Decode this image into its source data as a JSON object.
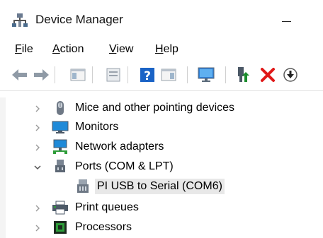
{
  "window": {
    "title": "Device Manager",
    "icon": "device-manager-icon"
  },
  "menu": {
    "items": [
      {
        "label_first": "F",
        "label_rest": "ile"
      },
      {
        "label_first": "A",
        "label_rest": "ction"
      },
      {
        "label_first": "V",
        "label_rest": "iew"
      },
      {
        "label_first": "H",
        "label_rest": "elp"
      }
    ]
  },
  "toolbar": {
    "buttons": [
      "back-arrow-icon",
      "forward-arrow-icon",
      "show-hide-console-tree-icon",
      "properties-icon",
      "help-icon",
      "action-pane-icon",
      "monitor-scan-icon",
      "enable-device-icon",
      "uninstall-x-icon",
      "update-driver-down-icon"
    ],
    "colors": {
      "blue": "#1a63c6",
      "red": "#e01818",
      "green": "#1a8c2c"
    }
  },
  "tree": {
    "rows": [
      {
        "label": "Mice and other pointing devices",
        "icon": "mouse-icon",
        "expander": "collapsed"
      },
      {
        "label": "Monitors",
        "icon": "monitor-icon",
        "expander": "collapsed"
      },
      {
        "label": "Network adapters",
        "icon": "network-adapter-icon",
        "expander": "collapsed"
      },
      {
        "label": "Ports (COM & LPT)",
        "icon": "port-icon",
        "expander": "expanded"
      },
      {
        "label": "PI USB to Serial (COM6)",
        "icon": "serial-port-icon",
        "expander": "none",
        "selected": true
      },
      {
        "label": "Print queues",
        "icon": "printer-icon",
        "expander": "collapsed"
      },
      {
        "label": "Processors",
        "icon": "processor-icon",
        "expander": "collapsed"
      }
    ]
  }
}
